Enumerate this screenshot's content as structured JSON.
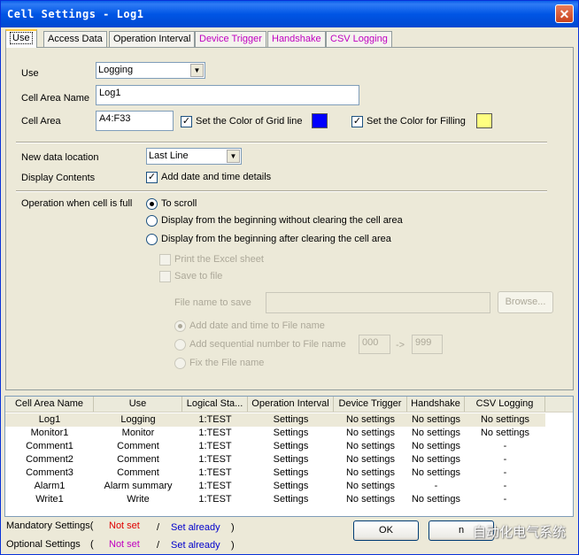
{
  "window": {
    "title": "Cell Settings - Log1"
  },
  "tabs": [
    {
      "label": "Use",
      "active": true
    },
    {
      "label": "Access Data"
    },
    {
      "label": "Operation Interval"
    },
    {
      "label": "Device Trigger"
    },
    {
      "label": "Handshake"
    },
    {
      "label": "CSV Logging"
    }
  ],
  "form": {
    "use_label": "Use",
    "use_value": "Logging",
    "cell_area_name_label": "Cell Area Name",
    "cell_area_name_value": "Log1",
    "cell_area_label": "Cell Area",
    "cell_area_value": "A4:F33",
    "grid_color_label": "Set the Color of Grid line",
    "grid_color": "#0000ff",
    "fill_color_label": "Set the Color for Filling",
    "fill_color": "#ffff80",
    "new_data_location_label": "New data location",
    "new_data_location_value": "Last Line",
    "display_contents_label": "Display Contents",
    "add_datetime_label": "Add date and time details",
    "when_full_label": "Operation when cell is full",
    "radio_scroll": "To scroll",
    "radio_no_clear": "Display from the beginning without clearing the cell area",
    "radio_clear": "Display from the beginning after clearing the cell area",
    "print_excel": "Print the Excel sheet",
    "save_file": "Save to file",
    "file_name_label": "File name to save",
    "browse": "Browse...",
    "add_datetime_file": "Add date and time to File name",
    "add_seq_file": "Add sequential number to File name",
    "seq_from": "000",
    "seq_arrow": "->",
    "seq_to": "999",
    "fix_file": "Fix the File name"
  },
  "table": {
    "headers": [
      "Cell Area Name",
      "Use",
      "Logical Sta...",
      "Operation Interval",
      "Device Trigger",
      "Handshake",
      "CSV Logging"
    ],
    "rows": [
      [
        "Log1",
        "Logging",
        "1:TEST",
        "Settings",
        "No settings",
        "No settings",
        "No settings"
      ],
      [
        "Monitor1",
        "Monitor",
        "1:TEST",
        "Settings",
        "No settings",
        "No settings",
        "No settings"
      ],
      [
        "Comment1",
        "Comment",
        "1:TEST",
        "Settings",
        "No settings",
        "No settings",
        "-"
      ],
      [
        "Comment2",
        "Comment",
        "1:TEST",
        "Settings",
        "No settings",
        "No settings",
        "-"
      ],
      [
        "Comment3",
        "Comment",
        "1:TEST",
        "Settings",
        "No settings",
        "No settings",
        "-"
      ],
      [
        "Alarm1",
        "Alarm summary",
        "1:TEST",
        "Settings",
        "No settings",
        "-",
        "-"
      ],
      [
        "Write1",
        "Write",
        "1:TEST",
        "Settings",
        "No settings",
        "No settings",
        "-"
      ]
    ]
  },
  "footer": {
    "mandatory_label": "Mandatory Settings(",
    "optional_label": "Optional Settings",
    "open_paren": "(",
    "not_set": "Not set",
    "slash": "/",
    "set_already": "Set already",
    "close_paren": ")",
    "ok": "OK",
    "second_button": "n",
    "watermark": "自动化电气系统"
  }
}
